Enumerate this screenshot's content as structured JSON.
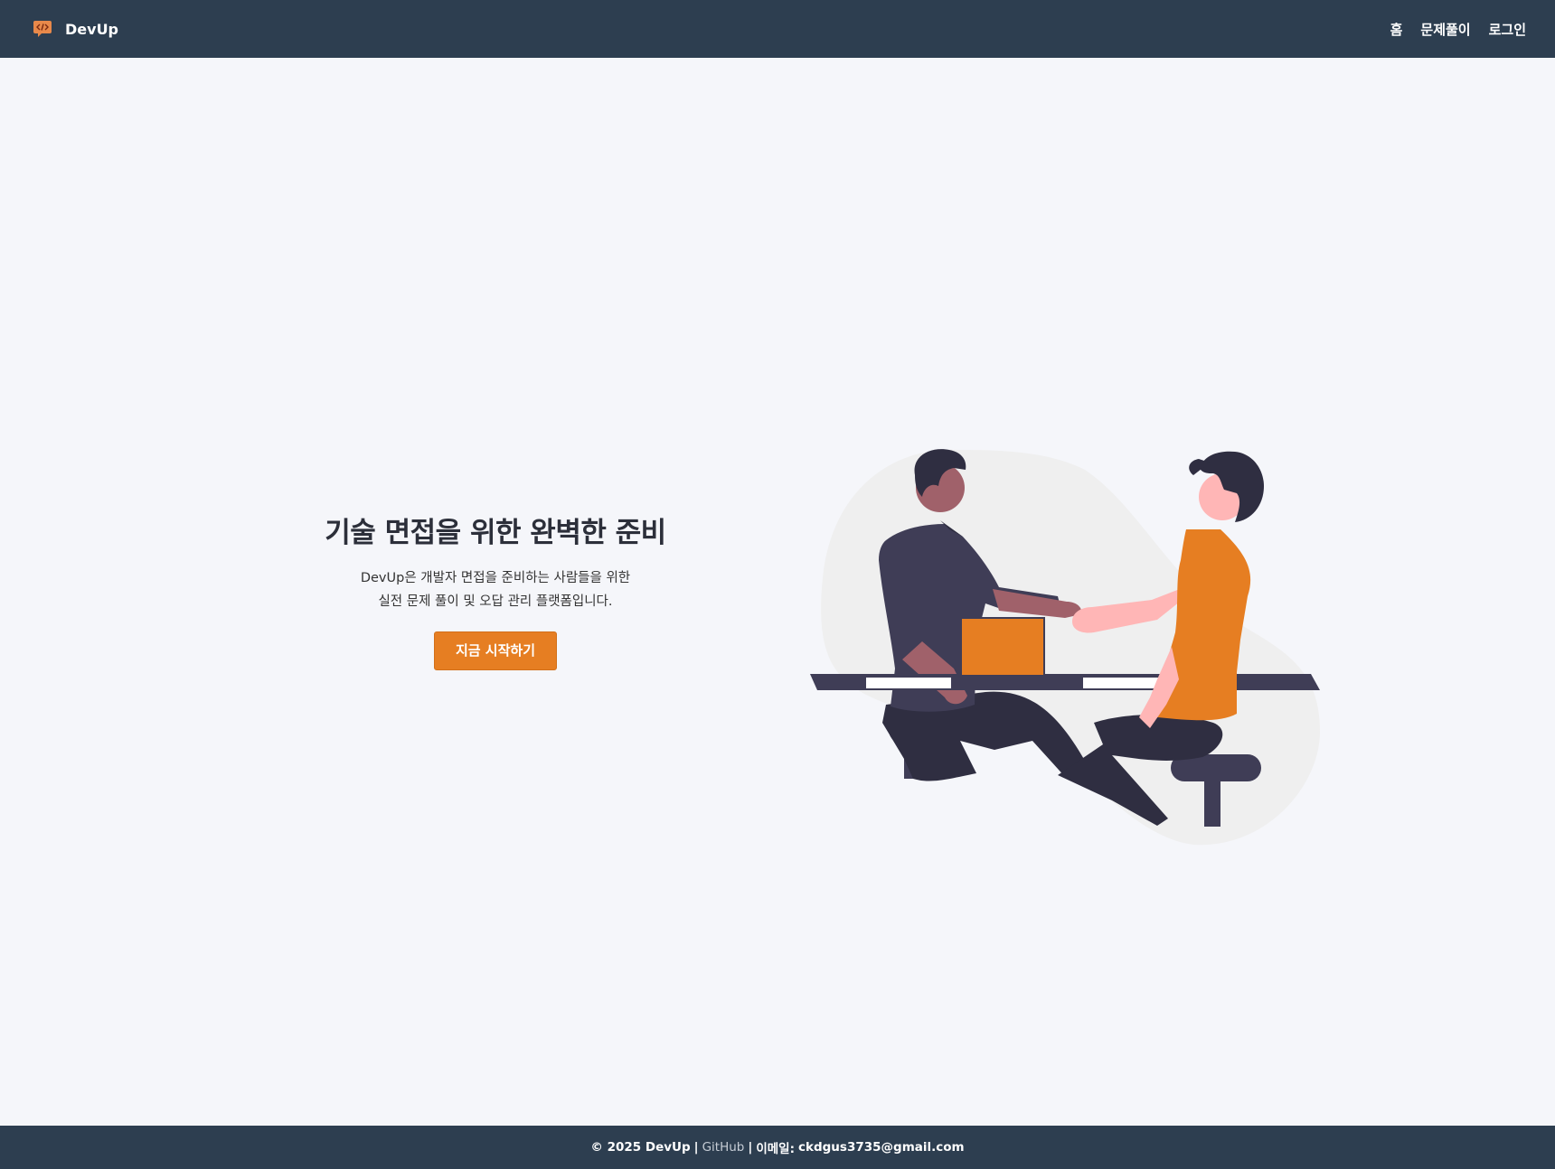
{
  "header": {
    "brand": "DevUp",
    "nav": {
      "home": "홈",
      "problems": "문제풀이",
      "login": "로그인"
    }
  },
  "hero": {
    "title": "기술 면접을 위한 완벽한 준비",
    "desc_line1": "DevUp은 개발자 면접을 준비하는 사람들을 위한",
    "desc_line2": "실전 문제 풀이 및 오답 관리 플랫폼입니다.",
    "cta": "지금 시작하기"
  },
  "footer": {
    "copyright": "© 2025 DevUp",
    "separator": "|",
    "github": "GitHub",
    "email_label": "이메일:",
    "email": "ckdgus3735@gmail.com"
  },
  "colors": {
    "header_bg": "#2d3e50",
    "accent": "#e67e22",
    "page_bg": "#f5f6fa"
  },
  "icons": {
    "brand": "code-chat-bubble-icon"
  }
}
